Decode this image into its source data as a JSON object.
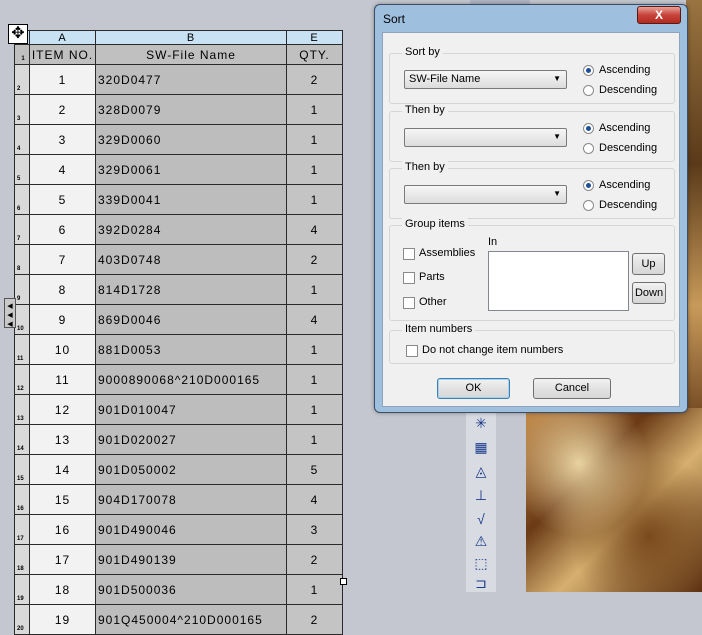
{
  "table": {
    "column_letters": [
      "A",
      "B",
      "E"
    ],
    "headers": {
      "item_no": "ITEM NO.",
      "file_name": "SW-File Name",
      "qty": "QTY."
    },
    "rows": [
      {
        "item": "1",
        "name": "320D0477",
        "qty": "2"
      },
      {
        "item": "2",
        "name": "328D0079",
        "qty": "1"
      },
      {
        "item": "3",
        "name": "329D0060",
        "qty": "1"
      },
      {
        "item": "4",
        "name": "329D0061",
        "qty": "1"
      },
      {
        "item": "5",
        "name": "339D0041",
        "qty": "1"
      },
      {
        "item": "6",
        "name": "392D0284",
        "qty": "4"
      },
      {
        "item": "7",
        "name": "403D0748",
        "qty": "2"
      },
      {
        "item": "8",
        "name": "814D1728",
        "qty": "1"
      },
      {
        "item": "9",
        "name": "869D0046",
        "qty": "4"
      },
      {
        "item": "10",
        "name": "881D0053",
        "qty": "1"
      },
      {
        "item": "11",
        "name": "9000890068^210D000165",
        "qty": "1"
      },
      {
        "item": "12",
        "name": "901D010047",
        "qty": "1"
      },
      {
        "item": "13",
        "name": "901D020027",
        "qty": "1"
      },
      {
        "item": "14",
        "name": "901D050002",
        "qty": "5"
      },
      {
        "item": "15",
        "name": "904D170078",
        "qty": "4"
      },
      {
        "item": "16",
        "name": "901D490046",
        "qty": "3"
      },
      {
        "item": "17",
        "name": "901D490139",
        "qty": "2"
      },
      {
        "item": "18",
        "name": "901D500036",
        "qty": "1"
      },
      {
        "item": "19",
        "name": "901Q450004^210D000165",
        "qty": "2"
      }
    ]
  },
  "dialog": {
    "title": "Sort",
    "close_label": "X",
    "sort_by": {
      "label": "Sort by",
      "value": "SW-File Name",
      "ascending": "Ascending",
      "descending": "Descending"
    },
    "then_by_1": {
      "label": "Then by",
      "value": "",
      "ascending": "Ascending",
      "descending": "Descending"
    },
    "then_by_2": {
      "label": "Then by",
      "value": "",
      "ascending": "Ascending",
      "descending": "Descending"
    },
    "group_items": {
      "label": "Group items",
      "assemblies": "Assemblies",
      "parts": "Parts",
      "other": "Other",
      "in_label": "In",
      "up": "Up",
      "down": "Down"
    },
    "item_numbers": {
      "label": "Item numbers",
      "checkbox": "Do not change item numbers"
    },
    "ok": "OK",
    "cancel": "Cancel"
  },
  "icons": {
    "move_handle": "move-arrows-icon",
    "side_handle": "triangle-handles-icon"
  }
}
